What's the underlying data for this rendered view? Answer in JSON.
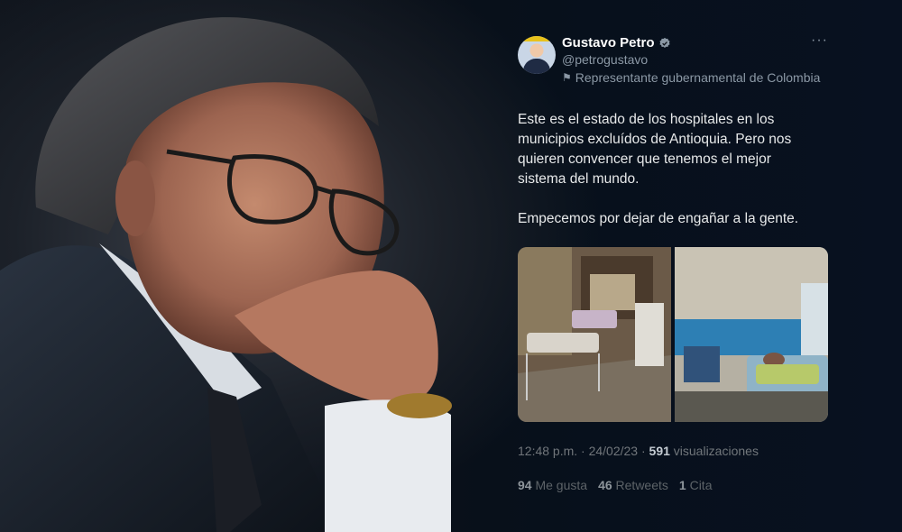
{
  "tweet": {
    "name": "Gustavo Petro",
    "handle": "@petrogustavo",
    "label": "Representante gubernamental de Colombia",
    "more": "···",
    "text_p1": "Este es el estado de los hospitales en los municipios excluídos de Antioquia.  Pero nos quieren convencer que tenemos el mejor sistema del mundo.",
    "text_p2": "Empecemos por dejar de engañar a la gente.",
    "time": "12:48 p.m. · 24/02/23 · ",
    "views_count": "591",
    "views_label": " visualizaciones",
    "likes_count": "94",
    "likes_label": "Me gusta",
    "retweets_count": "46",
    "retweets_label": "Retweets",
    "quotes_count": "1",
    "quotes_label": "Cita"
  },
  "colors": {
    "background": "#060b14",
    "text_primary": "#e7e9ea",
    "text_secondary": "#8b98a5",
    "verified": "#8b98a5"
  },
  "icons": {
    "verified": "verified-badge-icon",
    "government": "flag-icon",
    "more": "more-dots-icon"
  }
}
